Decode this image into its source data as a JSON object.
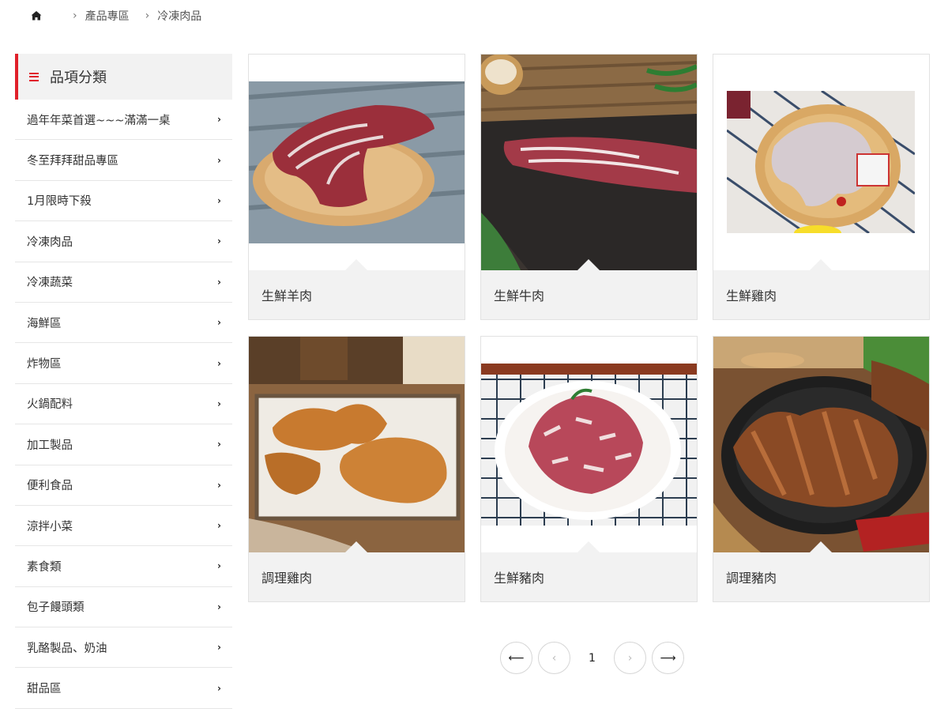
{
  "breadcrumb": {
    "home_icon": "home-icon",
    "items": [
      "產品專區",
      "冷凍肉品"
    ]
  },
  "sidebar": {
    "title": "品項分類",
    "accent_color": "#e0202a",
    "items": [
      {
        "label": "過年年菜首選~~~滿滿一桌"
      },
      {
        "label": "冬至拜拜甜品專區"
      },
      {
        "label": "1月限時下殺"
      },
      {
        "label": "冷凍肉品"
      },
      {
        "label": "冷凍蔬菜"
      },
      {
        "label": "海鮮區"
      },
      {
        "label": "炸物區"
      },
      {
        "label": "火鍋配料"
      },
      {
        "label": "加工製品"
      },
      {
        "label": "便利食品"
      },
      {
        "label": "涼拌小菜"
      },
      {
        "label": "素食類"
      },
      {
        "label": "包子饅頭類"
      },
      {
        "label": "乳酪製品、奶油"
      },
      {
        "label": "甜品區"
      }
    ]
  },
  "products": [
    {
      "name": "生鮮羊肉"
    },
    {
      "name": "生鮮牛肉"
    },
    {
      "name": "生鮮雞肉"
    },
    {
      "name": "調理雞肉"
    },
    {
      "name": "生鮮豬肉"
    },
    {
      "name": "調理豬肉"
    }
  ],
  "pagination": {
    "first": "⟵",
    "prev": "‹",
    "current": "1",
    "next": "›",
    "last": "⟶"
  }
}
